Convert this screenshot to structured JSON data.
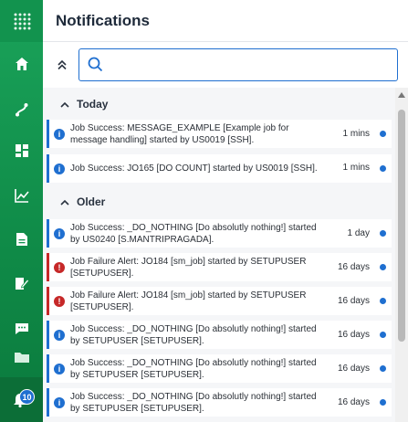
{
  "header": {
    "title": "Notifications"
  },
  "search": {
    "value": "",
    "placeholder": ""
  },
  "badge_count": "10",
  "rail_icons": [
    "apps-grid-icon",
    "home-icon",
    "workflow-icon",
    "dashboard-icon",
    "chart-icon",
    "document-icon",
    "edit-document-icon",
    "chat-icon",
    "folder-icon",
    "bell-icon"
  ],
  "sections": {
    "today": {
      "label": "Today"
    },
    "older": {
      "label": "Older"
    }
  },
  "notifications": [
    {
      "type": "info",
      "message": "Job Success: MESSAGE_EXAMPLE [Example job for message handling] started by US0019 [SSH].",
      "time": "1 mins"
    },
    {
      "type": "info",
      "message": "Job Success: JO165 [DO COUNT] started by US0019 [SSH].",
      "time": "1 mins"
    },
    {
      "type": "info",
      "message": "Job Success: _DO_NOTHING [Do absolutly nothing!] started by US0240 [S.MANTRIPRAGADA].",
      "time": "1 day"
    },
    {
      "type": "error",
      "message": "Job Failure Alert: JO184 [sm_job] started by SETUPUSER [SETUPUSER].",
      "time": "16 days"
    },
    {
      "type": "error",
      "message": "Job Failure Alert: JO184 [sm_job] started by SETUPUSER [SETUPUSER].",
      "time": "16 days"
    },
    {
      "type": "info",
      "message": "Job Success: _DO_NOTHING [Do absolutly nothing!] started by SETUPUSER [SETUPUSER].",
      "time": "16 days"
    },
    {
      "type": "info",
      "message": "Job Success: _DO_NOTHING [Do absolutly nothing!] started by SETUPUSER [SETUPUSER].",
      "time": "16 days"
    },
    {
      "type": "info",
      "message": "Job Success: _DO_NOTHING [Do absolutly nothing!] started by SETUPUSER [SETUPUSER].",
      "time": "16 days"
    }
  ],
  "colors": {
    "brand_green": "#12934e",
    "accent_blue": "#1f6fd0",
    "error_red": "#c62828"
  }
}
